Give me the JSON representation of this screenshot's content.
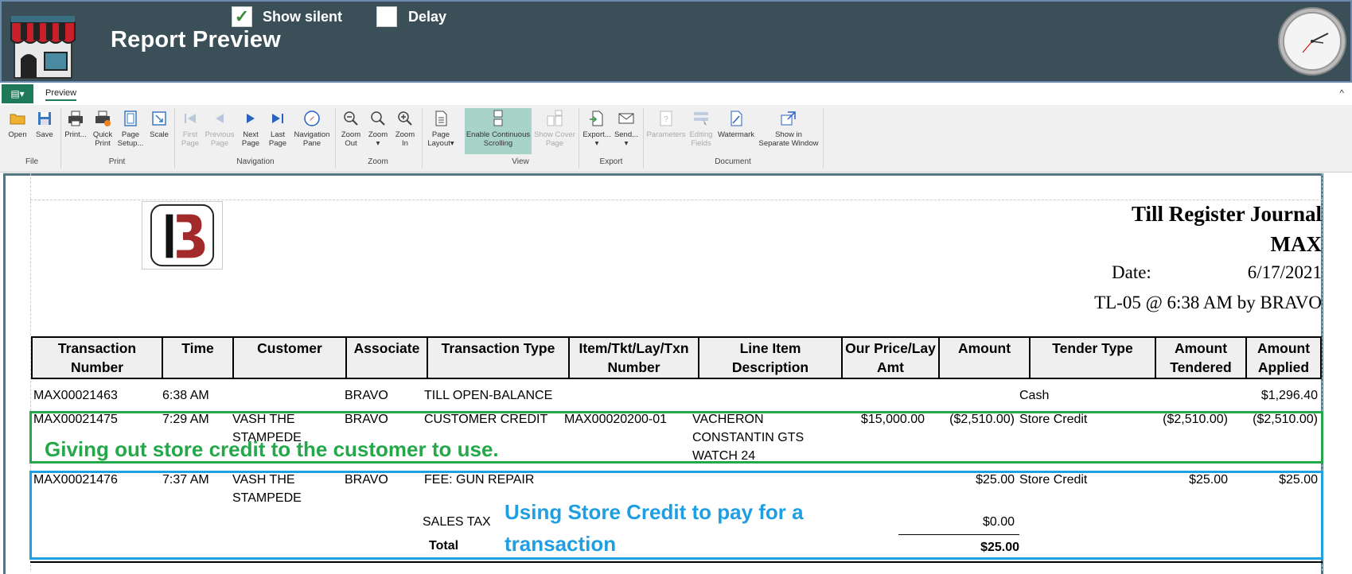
{
  "header": {
    "title": "Report Preview",
    "show_silent_label": "Show silent",
    "show_silent_checked": true,
    "show_silent_mark": "✓",
    "delay_label": "Delay",
    "delay_checked": false
  },
  "ribbon": {
    "app_button": "▤▾",
    "tab": "Preview",
    "collapse": "^",
    "groups": {
      "file": "File",
      "print": "Print",
      "navigation": "Navigation",
      "zoom": "Zoom",
      "view": "View",
      "export": "Export",
      "document": "Document"
    },
    "buttons": {
      "open": "Open",
      "save": "Save",
      "print": "Print...",
      "quick_print": "Quick\nPrint",
      "page_setup": "Page\nSetup...",
      "scale": "Scale",
      "first_page": "First\nPage",
      "previous_page": "Previous\nPage",
      "next_page": "Next\nPage",
      "last_page": "Last\nPage",
      "navigation_pane": "Navigation\nPane",
      "zoom_out": "Zoom\nOut",
      "zoom": "Zoom\n▾",
      "zoom_in": "Zoom\nIn",
      "page_layout": "Page\nLayout▾",
      "enable_continuous_scrolling": "Enable Continuous\nScrolling",
      "show_cover_page": "Show Cover\nPage",
      "export": "Export...\n▾",
      "send": "Send...\n▾",
      "parameters": "Parameters",
      "editing_fields": "Editing\nFields",
      "watermark": "Watermark",
      "show_in_separate_window": "Show in\nSeparate Window"
    }
  },
  "report": {
    "title": "Till Register Journal",
    "store": "MAX",
    "date_label": "Date:",
    "date_value": "6/17/2021",
    "till_line": "TL-05 @ 6:38 AM by BRAVO",
    "columns": [
      "Transaction\nNumber",
      "Time",
      "Customer",
      "Associate",
      "Transaction Type",
      "Item/Tkt/Lay/Txn\nNumber",
      "Line Item\nDescription",
      "Our Price/Lay\nAmt",
      "Amount",
      "Tender Type",
      "Amount\nTendered",
      "Amount\nApplied"
    ],
    "rows": [
      {
        "txn": "MAX00021463",
        "time": "6:38 AM",
        "customer": "",
        "associate": "BRAVO",
        "type": "TILL OPEN-BALANCE",
        "item": "",
        "desc": "",
        "price": "",
        "amount": "",
        "tender": "Cash",
        "tendered": "",
        "applied": "$1,296.40"
      },
      {
        "txn": "MAX00021475",
        "time": "7:29 AM",
        "customer": "VASH THE\nSTAMPEDE",
        "associate": "BRAVO",
        "type": "CUSTOMER CREDIT",
        "item": "MAX00020200-01",
        "desc": "VACHERON\nCONSTANTIN GTS\nWATCH 24",
        "price": "$15,000.00",
        "amount": "($2,510.00)",
        "tender": "Store Credit",
        "tendered": "($2,510.00)",
        "applied": "($2,510.00)"
      },
      {
        "txn": "MAX00021476",
        "time": "7:37 AM",
        "customer": "VASH THE\nSTAMPEDE",
        "associate": "BRAVO",
        "type": "FEE: GUN REPAIR",
        "item": "",
        "desc": "",
        "price": "",
        "amount": "$25.00",
        "tender": "Store Credit",
        "tendered": "$25.00",
        "applied": "$25.00"
      }
    ],
    "sales_tax_label": "SALES TAX",
    "sales_tax_value": "$0.00",
    "total_label": "Total",
    "total_value": "$25.00"
  },
  "annotations": {
    "green": "Giving out store credit to the customer to use.",
    "blue": "Using Store Credit to pay for a transaction",
    "green_color": "#24a84a",
    "blue_color": "#1f9fe2"
  }
}
